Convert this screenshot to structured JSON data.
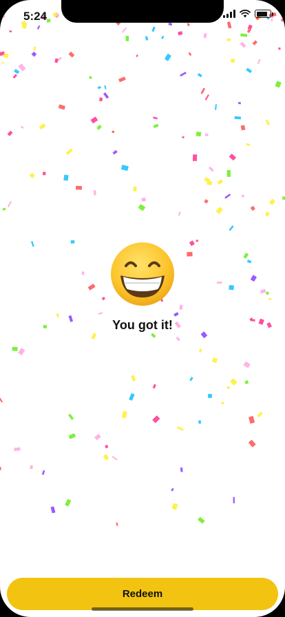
{
  "status_bar": {
    "time": "5:24",
    "battery_level": 0.85
  },
  "celebration": {
    "emoji_icon": "grinning-face-with-smiling-eyes-icon",
    "message": "You got it!",
    "confetti_colors": [
      "#ff4fa0",
      "#9b59ff",
      "#38c8ff",
      "#7cf03a",
      "#fff14a",
      "#ff6b6b",
      "#ffb3e6"
    ]
  },
  "footer": {
    "redeem_label": "Redeem",
    "accent_color": "#f2c311"
  }
}
